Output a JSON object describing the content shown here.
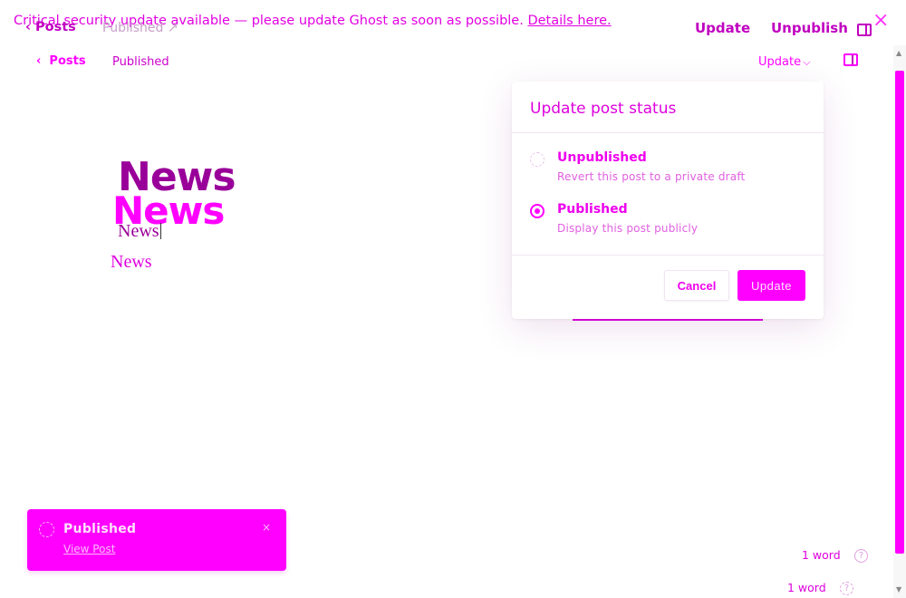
{
  "banner": {
    "message": "Critical security update available — please update Ghost as soon as possible.",
    "link": "Details here."
  },
  "ghost_header": {
    "back_label": "Posts",
    "status": "Published",
    "update_label": "Update",
    "unpublish_label": "Unpublish"
  },
  "editor_header": {
    "back_label": "Posts",
    "status": "Published",
    "update_dropdown": "Update"
  },
  "titles": {
    "a": "News",
    "b": "News",
    "c": "News",
    "d": "News"
  },
  "modal": {
    "title": "Update post status",
    "options": [
      {
        "label": "Unpublished",
        "description": "Revert this post to a private draft",
        "selected": false
      },
      {
        "label": "Published",
        "description": "Display this post publicly",
        "selected": true
      }
    ],
    "cancel_label": "Cancel",
    "update_label": "Update"
  },
  "toast": {
    "title": "Published",
    "link": "View Post",
    "close": "×"
  },
  "word_counts": {
    "upper": "1 word",
    "lower": "1 word"
  },
  "help_icon_glyph": "?",
  "close_glyph": "×",
  "colors": {
    "accent": "#ff00ff",
    "dark_accent": "#990099"
  }
}
